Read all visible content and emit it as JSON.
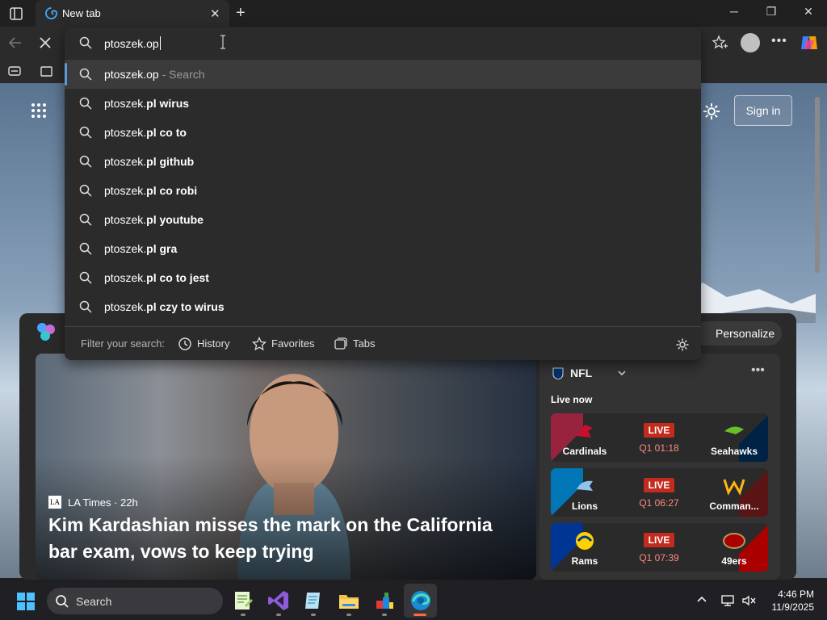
{
  "tab": {
    "title": "New tab"
  },
  "omnibox": {
    "typed_text": "ptoszek.op",
    "suggestions": [
      {
        "bold": "",
        "normal": "ptoszek.op",
        "hint": " - Search"
      },
      {
        "normal": "ptoszek.",
        "bold": "pl wirus"
      },
      {
        "normal": "ptoszek.",
        "bold": "pl co to"
      },
      {
        "normal": "ptoszek.",
        "bold": "pl github"
      },
      {
        "normal": "ptoszek.",
        "bold": "pl co robi"
      },
      {
        "normal": "ptoszek.",
        "bold": "pl youtube"
      },
      {
        "normal": "ptoszek.",
        "bold": "pl gra"
      },
      {
        "normal": "ptoszek.",
        "bold": "pl co to jest"
      },
      {
        "normal": "ptoszek.",
        "bold": "pl czy to wirus"
      }
    ],
    "filter": {
      "label": "Filter your search:",
      "history": "History",
      "favorites": "Favorites",
      "tabs": "Tabs"
    }
  },
  "newtab": {
    "signin_label": "Sign in",
    "personalize_label": "Personalize",
    "hero": {
      "source": "LA Times",
      "age": "22h",
      "source_line": "LA Times · 22h",
      "headline": "Kim Kardashian misses the mark on the California bar exam, vows to keep trying"
    },
    "nfl": {
      "title": "NFL",
      "live_now": "Live now",
      "live_badge": "LIVE",
      "games": [
        {
          "home": "Cardinals",
          "away": "Seahawks",
          "clock": "Q1 01:18",
          "home_color": "#97233f",
          "away_color": "#002244"
        },
        {
          "home": "Lions",
          "away": "Comman...",
          "clock": "Q1 06:27",
          "home_color": "#0076b6",
          "away_color": "#5a1414"
        },
        {
          "home": "Rams",
          "away": "49ers",
          "clock": "Q1 07:39",
          "home_color": "#003594",
          "away_color": "#aa0000"
        }
      ]
    }
  },
  "taskbar": {
    "search_placeholder": "Search",
    "time": "4:46 PM",
    "date": "11/9/2025"
  },
  "colors": {
    "accent": "#5b9bd5",
    "live_red": "#c42b1c",
    "chrome_bg": "#202020",
    "dropdown_bg": "#2b2b2b"
  }
}
